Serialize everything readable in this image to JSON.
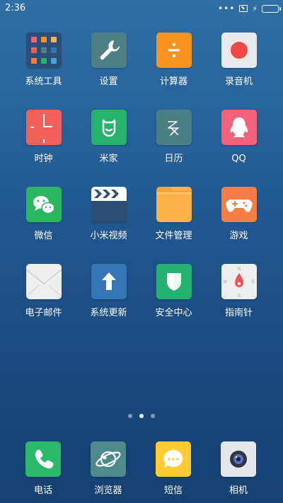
{
  "status": {
    "time": "2:36",
    "overflow": "•••",
    "battery_level": 1.0
  },
  "page_indicator": {
    "count": 3,
    "active_index": 1
  },
  "apps": [
    {
      "label": "系统工具",
      "icon": "folder-icon"
    },
    {
      "label": "设置",
      "icon": "wrench-icon"
    },
    {
      "label": "计算器",
      "icon": "divide-icon"
    },
    {
      "label": "录音机",
      "icon": "record-icon"
    },
    {
      "label": "时钟",
      "icon": "clock-icon"
    },
    {
      "label": "米家",
      "icon": "mijia-icon"
    },
    {
      "label": "日历",
      "icon": "calendar-icon"
    },
    {
      "label": "QQ",
      "icon": "penguin-icon"
    },
    {
      "label": "微信",
      "icon": "wechat-icon"
    },
    {
      "label": "小米视频",
      "icon": "video-icon"
    },
    {
      "label": "文件管理",
      "icon": "file-folder-icon"
    },
    {
      "label": "游戏",
      "icon": "gamepad-icon"
    },
    {
      "label": "电子邮件",
      "icon": "envelope-icon"
    },
    {
      "label": "系统更新",
      "icon": "update-arrow-icon"
    },
    {
      "label": "安全中心",
      "icon": "shield-icon"
    },
    {
      "label": "指南针",
      "icon": "compass-icon"
    }
  ],
  "dock": [
    {
      "label": "电话",
      "icon": "phone-icon"
    },
    {
      "label": "浏览器",
      "icon": "browser-icon"
    },
    {
      "label": "短信",
      "icon": "message-icon"
    },
    {
      "label": "相机",
      "icon": "camera-icon"
    }
  ],
  "colors": {
    "tools_bg": "#2b4f78",
    "settings_bg": "#4f7f86",
    "calc_bg": "#f7931e",
    "recorder_bg": "#e9eaec",
    "recorder_dot": "#f0484a",
    "clock_bg": "#f2605a",
    "mijia_bg": "#27b36b",
    "calendar_bg": "#4b7f84",
    "qq_bg": "#f2627a",
    "wechat_bg": "#2bb75f",
    "video_bg": "#2c4e73",
    "files_bg": "#fbb24b",
    "games_bg": "#f47e45",
    "mail_bg": "#eeeeee",
    "update_bg": "#3475b3",
    "security_bg": "#24b271",
    "compass_bg": "#eeeeee",
    "phone_bg": "#2bb86a",
    "browser_bg": "#4e8a8c",
    "sms_bg": "#ffcc33",
    "camera_bg": "#e4e6ea",
    "battery": "#4cd964"
  }
}
